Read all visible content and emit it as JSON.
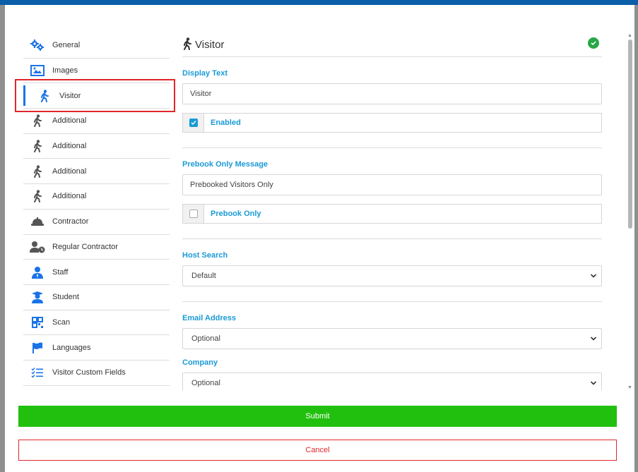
{
  "nav": {
    "items": [
      {
        "label": "General",
        "icon": "gears-icon"
      },
      {
        "label": "Images",
        "icon": "image-icon"
      },
      {
        "label": "Visitor",
        "icon": "walking-person-icon",
        "active": true
      },
      {
        "label": "Additional",
        "icon": "walking-person-icon"
      },
      {
        "label": "Additional",
        "icon": "walking-person-icon"
      },
      {
        "label": "Additional",
        "icon": "walking-person-icon"
      },
      {
        "label": "Additional",
        "icon": "walking-person-icon"
      },
      {
        "label": "Contractor",
        "icon": "hard-hat-icon"
      },
      {
        "label": "Regular Contractor",
        "icon": "user-clock-icon"
      },
      {
        "label": "Staff",
        "icon": "user-tie-icon"
      },
      {
        "label": "Student",
        "icon": "graduate-icon"
      },
      {
        "label": "Scan",
        "icon": "qr-code-icon"
      },
      {
        "label": "Languages",
        "icon": "flag-icon"
      },
      {
        "label": "Visitor Custom Fields",
        "icon": "checklist-icon"
      }
    ]
  },
  "content": {
    "title": "Visitor",
    "display_text": {
      "label": "Display Text",
      "value": "Visitor"
    },
    "enabled": {
      "label": "Enabled",
      "checked": true
    },
    "prebook_message": {
      "label": "Prebook Only Message",
      "value": "Prebooked Visitors Only"
    },
    "prebook_only": {
      "label": "Prebook Only",
      "checked": false
    },
    "host_search": {
      "label": "Host Search",
      "value": "Default"
    },
    "email_address": {
      "label": "Email Address",
      "value": "Optional"
    },
    "company": {
      "label": "Company",
      "value": "Optional"
    }
  },
  "footer": {
    "submit_label": "Submit",
    "cancel_label": "Cancel"
  },
  "colors": {
    "accent": "#1a9ad6",
    "submit": "#22c00e",
    "cancel": "#e0262b",
    "success": "#28a745",
    "nav_icon": "#1a73e8"
  }
}
